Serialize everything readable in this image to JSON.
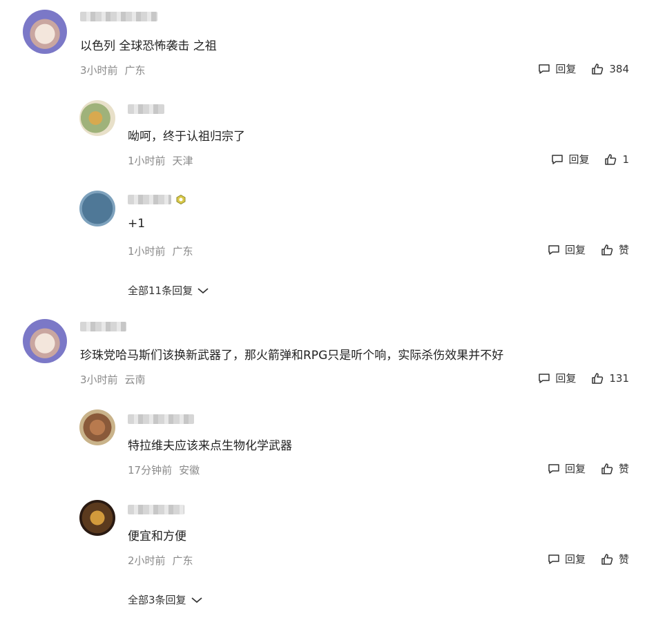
{
  "threads": [
    {
      "comment": {
        "content": "以色列 全球恐怖袭击 之祖",
        "time": "3小时前",
        "location": "广东",
        "reply_label": "回复",
        "like_label": "384"
      },
      "replies": [
        {
          "content": "呦呵，终于认祖归宗了",
          "time": "1小时前",
          "location": "天津",
          "reply_label": "回复",
          "like_label": "1"
        },
        {
          "content": "+1",
          "time": "1小时前",
          "location": "广东",
          "reply_label": "回复",
          "like_label": "赞"
        }
      ],
      "more_replies": "全部11条回复"
    },
    {
      "comment": {
        "content": "珍珠党哈马斯们该换新武器了，那火箭弹和RPG只是听个响，实际杀伤效果并不好",
        "time": "3小时前",
        "location": "云南",
        "reply_label": "回复",
        "like_label": "131"
      },
      "replies": [
        {
          "content": "特拉维夫应该来点生物化学武器",
          "time": "17分钟前",
          "location": "安徽",
          "reply_label": "回复",
          "like_label": "赞"
        },
        {
          "content": "便宜和方便",
          "time": "2小时前",
          "location": "广东",
          "reply_label": "回复",
          "like_label": "赞"
        }
      ],
      "more_replies": "全部3条回复"
    }
  ],
  "icons": {
    "reply": "comment-bubble-icon",
    "like": "thumbs-up-icon",
    "expand": "chevron-down-icon",
    "badge": "level-badge-icon"
  },
  "colors": {
    "text": "#222222",
    "meta": "#8a8a8a",
    "background": "#ffffff"
  }
}
